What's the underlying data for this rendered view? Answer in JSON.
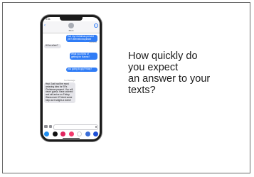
{
  "slide": {
    "question_lines": [
      "How quickly do",
      "you expect",
      "an answer to your",
      "texts?"
    ]
  },
  "phone": {
    "status_time": "9:41",
    "contact_name": "Mom",
    "messages": [
      {
        "dir": "out",
        "text": "Got my Christmas present yet? #letmeknowplease"
      },
      {
        "dir": "meta",
        "text": "Delivered"
      },
      {
        "dir": "in",
        "text": "Hi for a fee?"
      },
      {
        "dir": "out",
        "text": "What you think of getting for Nanna?"
      },
      {
        "dir": "out",
        "text": "you going to gig Friday?"
      },
      {
        "dir": "meta",
        "text": "Text Message"
      },
      {
        "dir": "in",
        "text": "Hey! Just had the most amazing idea for Elf's Christmas present. You will never guess. Have ordered and will arrive on Friday. Wanna see it? Need some help as it weighs a tonne!"
      }
    ],
    "icons": {
      "back": "chevron-left-icon",
      "info": "info-icon",
      "camera": "camera-icon",
      "apps": "app-store-icon",
      "mic": "mic-icon"
    },
    "app_icons": [
      {
        "name": "app-store-icon",
        "color": "#1f8ef1"
      },
      {
        "name": "apple-pay-icon",
        "color": "#111111"
      },
      {
        "name": "music-app-icon",
        "color": "#e0245e"
      },
      {
        "name": "sticker-app-icon",
        "color": "#f23a6b"
      },
      {
        "name": "photos-app-icon",
        "color": "#ffffff"
      },
      {
        "name": "search-app-icon",
        "color": "#3a6ed8"
      },
      {
        "name": "more-apps-icon",
        "color": "#1c4fd6"
      }
    ]
  }
}
